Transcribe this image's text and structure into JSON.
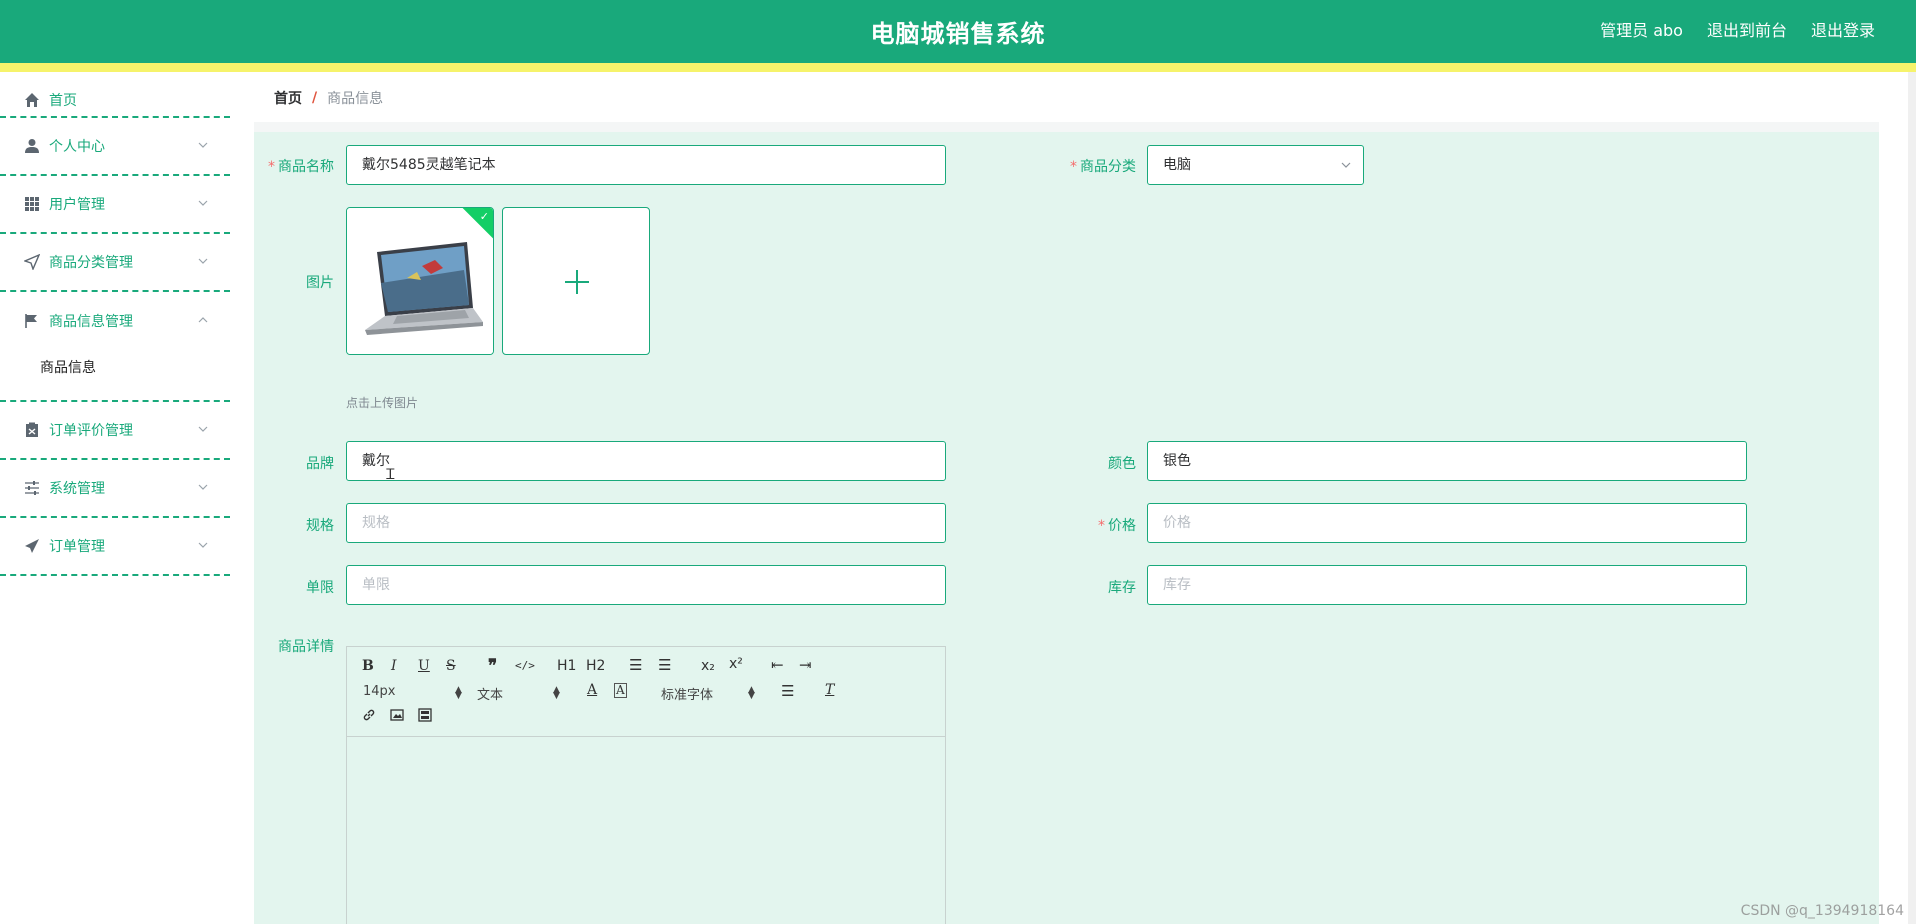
{
  "header": {
    "title": "电脑城销售系统",
    "admin_label": "管理员 abo",
    "to_frontend_label": "退出到前台",
    "logout_label": "退出登录"
  },
  "sidebar": {
    "items": [
      {
        "label": "首页",
        "icon": "home-icon"
      },
      {
        "label": "个人中心",
        "icon": "user-icon"
      },
      {
        "label": "用户管理",
        "icon": "grid-icon"
      },
      {
        "label": "商品分类管理",
        "icon": "send-icon"
      },
      {
        "label": "商品信息管理",
        "icon": "flag-icon"
      },
      {
        "label": "订单评价管理",
        "icon": "clipboard-icon"
      },
      {
        "label": "系统管理",
        "icon": "sliders-icon"
      },
      {
        "label": "订单管理",
        "icon": "paper-plane-icon"
      }
    ],
    "submenu": {
      "label": "商品信息"
    }
  },
  "breadcrumb": {
    "home": "首页",
    "separator": "/",
    "current": "商品信息"
  },
  "form": {
    "name_label": "商品名称",
    "name_value": "戴尔5485灵越笔记本",
    "category_label": "商品分类",
    "category_value": "电脑",
    "image_label": "图片",
    "upload_tip": "点击上传图片",
    "brand_label": "品牌",
    "brand_value": "戴尔",
    "color_label": "颜色",
    "color_value": "银色",
    "spec_label": "规格",
    "spec_placeholder": "规格",
    "price_label": "价格",
    "price_placeholder": "价格",
    "limit_label": "单限",
    "limit_placeholder": "单限",
    "stock_label": "库存",
    "stock_placeholder": "库存",
    "detail_label": "商品详情"
  },
  "editor": {
    "font_size": "14px",
    "text_type": "文本",
    "font_family": "标准字体",
    "h1": "H1",
    "h2": "H2"
  },
  "watermark": "CSDN @q_1394918164",
  "colors": {
    "brand": "#19a97b",
    "stripe": "#f6f36b",
    "form_bg": "#e3f5ee",
    "required": "#f56c6c"
  }
}
